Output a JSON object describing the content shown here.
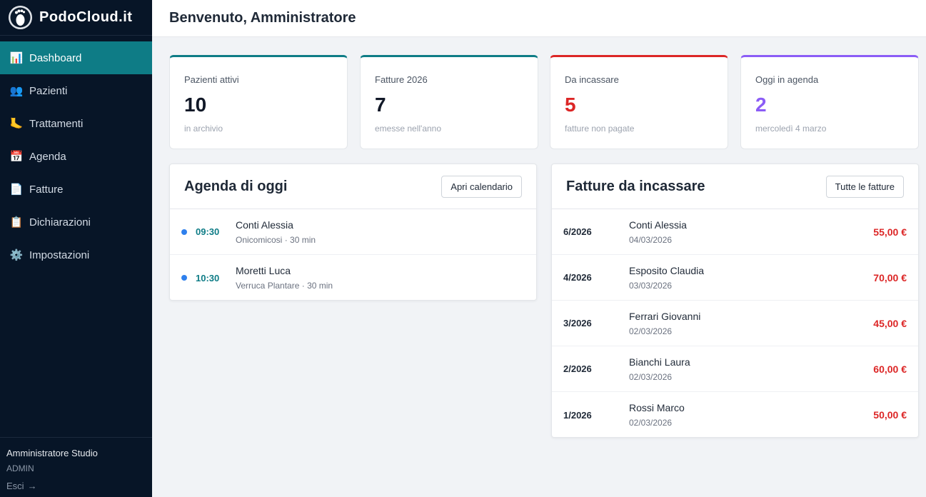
{
  "app": {
    "name": "PodoCloud.it",
    "logo_icon": "foot-logo-icon"
  },
  "sidebar": {
    "items": [
      {
        "label": "Dashboard",
        "icon": "📊",
        "icon_name": "chart-icon",
        "active": true
      },
      {
        "label": "Pazienti",
        "icon": "👥",
        "icon_name": "users-icon"
      },
      {
        "label": "Trattamenti",
        "icon": "🦶",
        "icon_name": "foot-icon"
      },
      {
        "label": "Agenda",
        "icon": "📅",
        "icon_name": "calendar-icon"
      },
      {
        "label": "Fatture",
        "icon": "📄",
        "icon_name": "document-icon"
      },
      {
        "label": "Dichiarazioni",
        "icon": "📋",
        "icon_name": "clipboard-icon"
      },
      {
        "label": "Impostazioni",
        "icon": "⚙️",
        "icon_name": "gear-icon"
      }
    ],
    "user": {
      "name": "Amministratore Studio",
      "role": "ADMIN",
      "logout_label": "Esci",
      "logout_arrow": "→"
    }
  },
  "header": {
    "title": "Benvenuto, Amministratore"
  },
  "stats": [
    {
      "label": "Pazienti attivi",
      "value": "10",
      "sub": "in archivio",
      "accent": "#0e7c86",
      "value_color": "#111827"
    },
    {
      "label": "Fatture 2026",
      "value": "7",
      "sub": "emesse nell'anno",
      "accent": "#0e7c86",
      "value_color": "#111827"
    },
    {
      "label": "Da incassare",
      "value": "5",
      "sub": "fatture non pagate",
      "accent": "#dc2626",
      "value_color": "#dc2626"
    },
    {
      "label": "Oggi in agenda",
      "value": "2",
      "sub": "mercoledì 4 marzo",
      "accent": "#8b5cf6",
      "value_color": "#8b5cf6"
    }
  ],
  "agenda": {
    "title": "Agenda di oggi",
    "button_label": "Apri calendario",
    "items": [
      {
        "time": "09:30",
        "patient": "Conti Alessia",
        "treatment": "Onicomicosi",
        "duration": "30 min"
      },
      {
        "time": "10:30",
        "patient": "Moretti Luca",
        "treatment": "Verruca Plantare",
        "duration": "30 min"
      }
    ]
  },
  "invoices": {
    "title": "Fatture da incassare",
    "button_label": "Tutte le fatture",
    "items": [
      {
        "number": "6/2026",
        "patient": "Conti Alessia",
        "date": "04/03/2026",
        "amount": "55,00 €"
      },
      {
        "number": "4/2026",
        "patient": "Esposito Claudia",
        "date": "03/03/2026",
        "amount": "70,00 €"
      },
      {
        "number": "3/2026",
        "patient": "Ferrari Giovanni",
        "date": "02/03/2026",
        "amount": "45,00 €"
      },
      {
        "number": "2/2026",
        "patient": "Bianchi Laura",
        "date": "02/03/2026",
        "amount": "60,00 €"
      },
      {
        "number": "1/2026",
        "patient": "Rossi Marco",
        "date": "02/03/2026",
        "amount": "50,00 €"
      }
    ]
  },
  "colors": {
    "sidebar_bg": "#071527",
    "active_bg": "#0e7c86",
    "amount": "#dc2626",
    "dot": "#2f80ed"
  }
}
